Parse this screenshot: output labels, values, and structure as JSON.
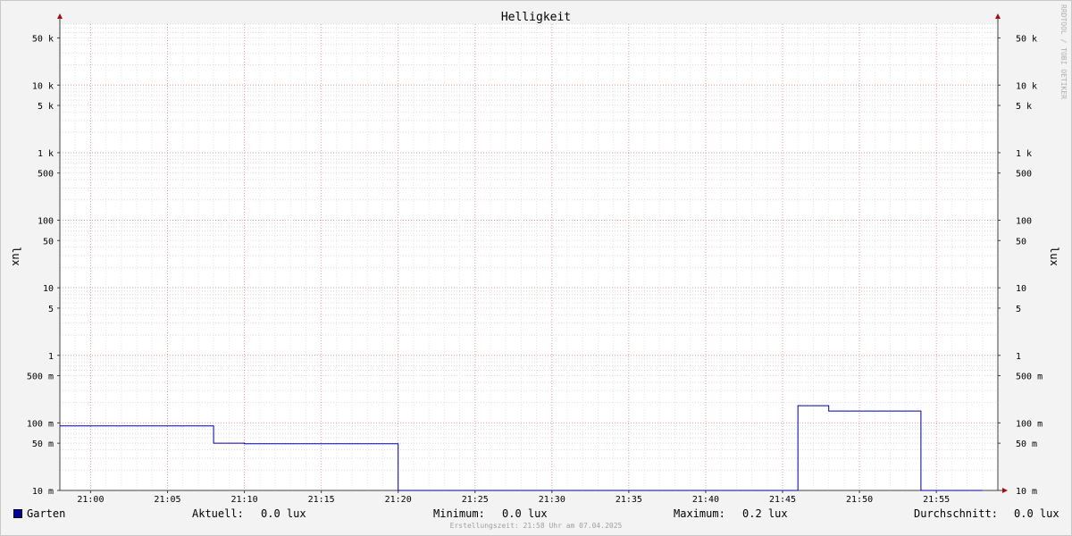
{
  "chart_data": {
    "type": "line",
    "title": "Helligkeit",
    "ylabel_left": "lux",
    "ylabel_right": "lux",
    "y_scale": "log",
    "ylim": [
      0.01,
      80000
    ],
    "y_ticks": [
      {
        "value": 50000,
        "label": "50 k"
      },
      {
        "value": 10000,
        "label": "10 k"
      },
      {
        "value": 5000,
        "label": "5 k"
      },
      {
        "value": 1000,
        "label": "1 k"
      },
      {
        "value": 500,
        "label": "500"
      },
      {
        "value": 100,
        "label": "100"
      },
      {
        "value": 50,
        "label": "50"
      },
      {
        "value": 10,
        "label": "10"
      },
      {
        "value": 5,
        "label": "5"
      },
      {
        "value": 1,
        "label": "1"
      },
      {
        "value": 0.5,
        "label": "500 m"
      },
      {
        "value": 0.1,
        "label": "100 m"
      },
      {
        "value": 0.05,
        "label": "50 m"
      },
      {
        "value": 0.01,
        "label": "10 m"
      }
    ],
    "x_ticks": [
      "21:00",
      "21:05",
      "21:10",
      "21:15",
      "21:20",
      "21:25",
      "21:30",
      "21:35",
      "21:40",
      "21:45",
      "21:50",
      "21:55"
    ],
    "xlim": [
      "20:58",
      "21:59"
    ],
    "grid": true,
    "series": [
      {
        "name": "Garten",
        "color": "#0000a0",
        "points": [
          {
            "x": "20:58",
            "y": 0.09
          },
          {
            "x": "21:08",
            "y": 0.09
          },
          {
            "x": "21:08",
            "y": 0.05
          },
          {
            "x": "21:10",
            "y": 0.05
          },
          {
            "x": "21:10",
            "y": 0.049
          },
          {
            "x": "21:20",
            "y": 0.049
          },
          {
            "x": "21:20",
            "y": 0.01
          },
          {
            "x": "21:46",
            "y": 0.01
          },
          {
            "x": "21:46",
            "y": 0.18
          },
          {
            "x": "21:48",
            "y": 0.18
          },
          {
            "x": "21:48",
            "y": 0.15
          },
          {
            "x": "21:54",
            "y": 0.15
          },
          {
            "x": "21:54",
            "y": 0.01
          },
          {
            "x": "21:58",
            "y": 0.01
          }
        ]
      }
    ]
  },
  "legend": {
    "series_name": "Garten",
    "current_label": "Aktuell:",
    "current_value": "0.0 lux",
    "min_label": "Minimum:",
    "min_value": "0.0 lux",
    "max_label": "Maximum:",
    "max_value": "0.2 lux",
    "avg_label": "Durchschnitt:",
    "avg_value": "0.0 lux"
  },
  "footer": "Erstellungszeit: 21:58 Uhr am 07.04.2025",
  "watermark": "RRDTOOL / TOBI OETIKER"
}
